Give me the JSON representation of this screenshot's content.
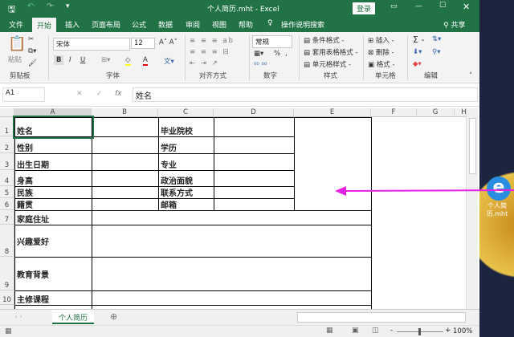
{
  "window": {
    "title": "个人简历.mht  -  Excel",
    "login": "登录",
    "share": "共享"
  },
  "tabs": [
    "文件",
    "开始",
    "插入",
    "页面布局",
    "公式",
    "数据",
    "审阅",
    "视图",
    "帮助"
  ],
  "search_label": "操作说明搜索",
  "ribbon": {
    "clipboard": {
      "paste": "粘贴",
      "label": "剪贴板"
    },
    "font": {
      "name": "宋体",
      "size": "12",
      "bold": "B",
      "italic": "I",
      "underline": "U",
      "label": "字体"
    },
    "alignment": {
      "label": "对齐方式"
    },
    "number": {
      "format": "常规",
      "percent": "%",
      "comma": ",",
      "label": "数字"
    },
    "styles": {
      "items": [
        "条件格式 -",
        "套用表格格式 -",
        "单元格样式 -"
      ],
      "label": "样式"
    },
    "cells": {
      "items": [
        "插入 -",
        "删除 -",
        "格式 -"
      ],
      "label": "单元格"
    },
    "editing": {
      "sum": "Σ -",
      "label": "编辑"
    }
  },
  "formula_bar": {
    "name_box": "A1",
    "value": "姓名"
  },
  "columns": [
    "A",
    "B",
    "C",
    "D",
    "E",
    "F",
    "G",
    "H"
  ],
  "rows": [
    "1",
    "2",
    "3",
    "4",
    "5",
    "6",
    "7",
    "8",
    "9",
    "10"
  ],
  "cells": {
    "A1": "姓名",
    "A2": "性别",
    "A3": "出生日期",
    "A4": "身高",
    "A5": "民族",
    "A6": "籍贯",
    "A7": "家庭住址",
    "A8": "兴趣爱好",
    "A9": "教育背景",
    "A10": "主修课程",
    "C1": "毕业院校",
    "C2": "学历",
    "C3": "专业",
    "C4": "政治面貌",
    "C5": "联系方式",
    "C6": "邮箱"
  },
  "sheet_tab": "个人简历",
  "zoom": "100%",
  "desktop_icon": {
    "label": "个人简历.mht"
  },
  "colors": {
    "excel_green": "#217346",
    "arrow": "#e61fe6"
  }
}
